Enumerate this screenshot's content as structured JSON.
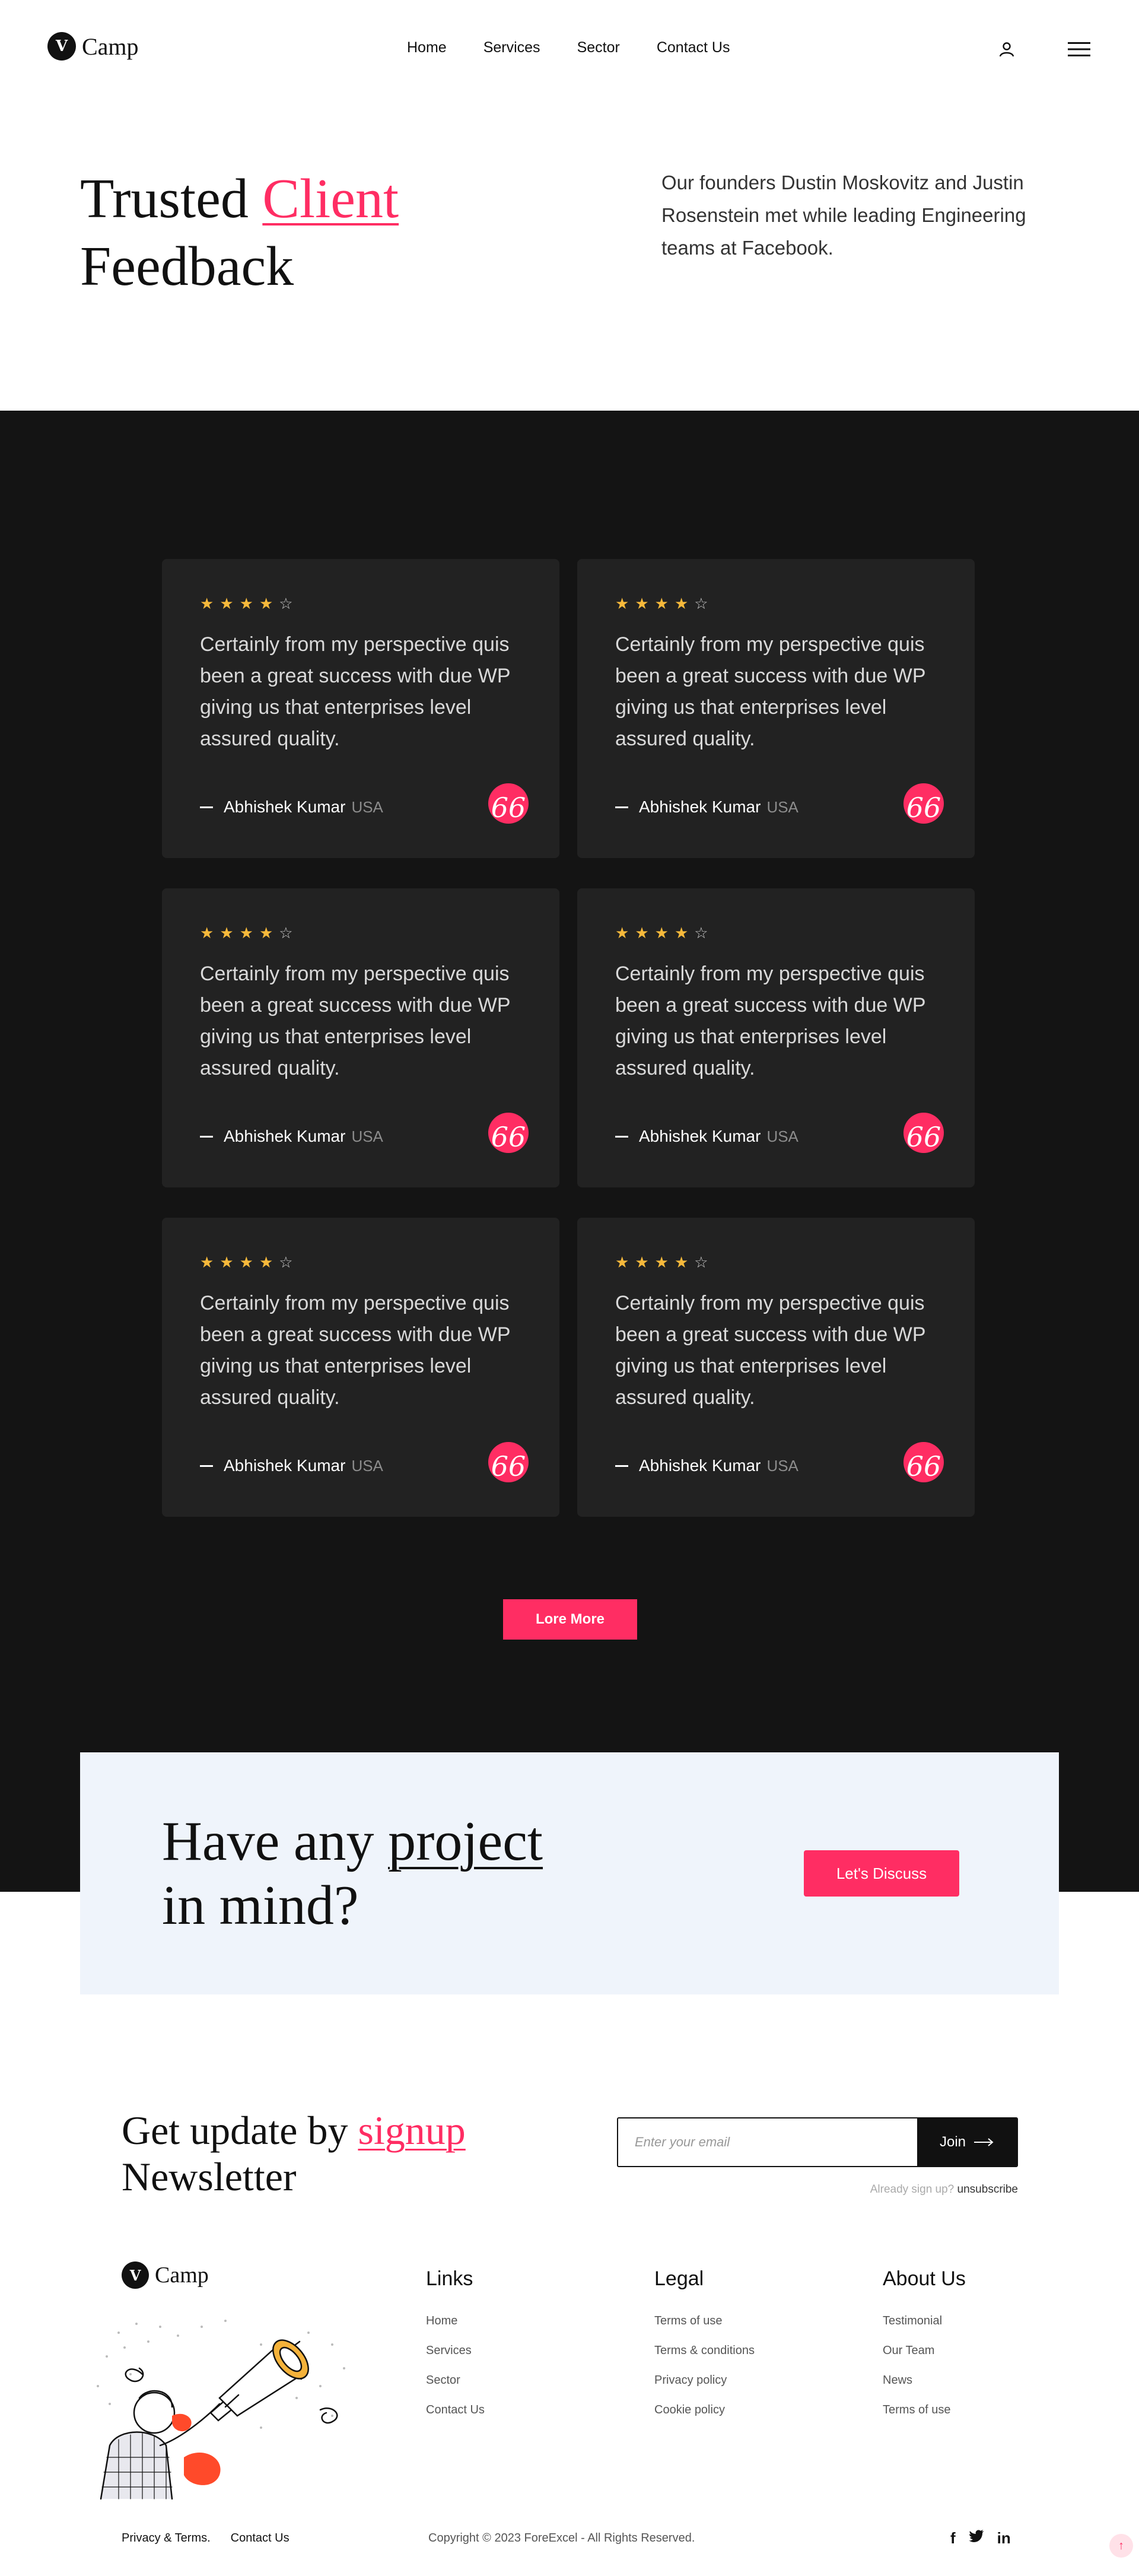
{
  "header": {
    "logo_letter": "V",
    "logo_text": "Camp",
    "nav": [
      "Home",
      "Services",
      "Sector",
      "Contact Us"
    ],
    "icons": [
      "user-icon",
      "menu-icon"
    ]
  },
  "hero": {
    "title_part1": "Trusted ",
    "title_accent": "Client",
    "title_part2": "Feedback",
    "description": "Our founders Dustin Moskovitz and Justin Rosenstein met while leading Engineering teams at Facebook."
  },
  "testimonials": {
    "items": [
      {
        "rating": 4,
        "max_rating": 5,
        "quote": "Certainly from my perspective quis been a great success with due WP giving us that enterprises level assured quality.",
        "name": "Abhishek Kumar",
        "location": "USA"
      },
      {
        "rating": 4,
        "max_rating": 5,
        "quote": "Certainly from my perspective quis been a great success with due WP giving us that enterprises level assured quality.",
        "name": "Abhishek Kumar",
        "location": "USA"
      },
      {
        "rating": 4,
        "max_rating": 5,
        "quote": "Certainly from my perspective quis been a great success with due WP giving us that enterprises level assured quality.",
        "name": "Abhishek Kumar",
        "location": "USA"
      },
      {
        "rating": 4,
        "max_rating": 5,
        "quote": "Certainly from my perspective quis been a great success with due WP giving us that enterprises level assured quality.",
        "name": "Abhishek Kumar",
        "location": "USA"
      },
      {
        "rating": 4,
        "max_rating": 5,
        "quote": "Certainly from my perspective quis been a great success with due WP giving us that enterprises level assured quality.",
        "name": "Abhishek Kumar",
        "location": "USA"
      },
      {
        "rating": 4,
        "max_rating": 5,
        "quote": "Certainly from my perspective quis been a great success with due WP giving us that enterprises level assured quality.",
        "name": "Abhishek Kumar",
        "location": "USA"
      }
    ],
    "quote_glyph": "66",
    "more_label": "Lore More"
  },
  "cta": {
    "title_part1": "Have any ",
    "title_underlined": "project",
    "title_part2": "in mind?",
    "button_label": "Let's Discuss"
  },
  "newsletter": {
    "title_part1": "Get update by ",
    "title_accent": "signup",
    "title_part2": "Newsletter",
    "placeholder": "Enter your email",
    "join_label": "Join",
    "note_prefix": "Already sign up?",
    "note_link": "unsubscribe"
  },
  "footer": {
    "logo_letter": "V",
    "logo_text": "Camp",
    "columns": [
      {
        "title": "Links",
        "items": [
          "Home",
          "Services",
          "Sector",
          "Contact Us"
        ]
      },
      {
        "title": "Legal",
        "items": [
          "Terms of use",
          "Terms & conditions",
          "Privacy policy",
          "Cookie policy"
        ]
      },
      {
        "title": "About Us",
        "items": [
          "Testimonial",
          "Our Team",
          "News",
          "Terms of use"
        ]
      }
    ],
    "bottom_links": [
      "Privacy & Terms.",
      "Contact Us"
    ],
    "copyright": "Copyright © 2023 ForeExcel - All Rights Reserved.",
    "social": [
      {
        "icon": "facebook-icon",
        "glyph": "f"
      },
      {
        "icon": "twitter-icon",
        "glyph": "t"
      },
      {
        "icon": "linkedin-icon",
        "glyph": "in"
      }
    ]
  },
  "colors": {
    "accent": "#ff2d63",
    "dark_bg": "#141414",
    "card_bg": "#222222",
    "star": "#f6b93b",
    "cta_bg": "#eff4fb"
  }
}
